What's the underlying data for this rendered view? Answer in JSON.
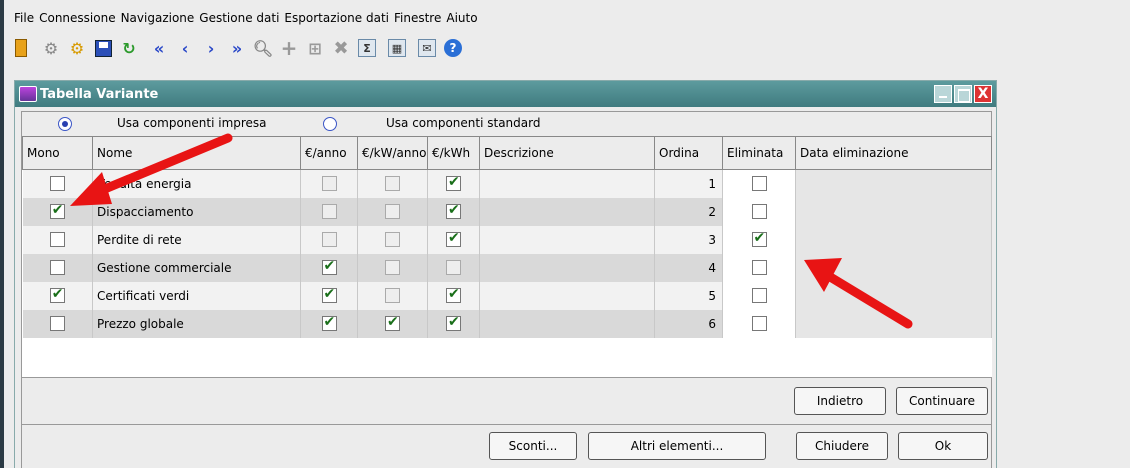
{
  "menu": [
    "File",
    "Connessione",
    "Navigazione",
    "Gestione dati",
    "Esportazione dati",
    "Finestre",
    "Aiuto"
  ],
  "window": {
    "title": "Tabella Variante",
    "close_glyph": "X"
  },
  "radio": {
    "impresa_label": "Usa componenti impresa",
    "standard_label": "Usa componenti standard",
    "selected": "impresa"
  },
  "columns": [
    "Mono",
    "Nome",
    "€/anno",
    "€/kW/anno",
    "€/kWh",
    "Descrizione",
    "Ordina",
    "Eliminata",
    "Data eliminazione"
  ],
  "rows": [
    {
      "mono": false,
      "nome": "Vendita energia",
      "anno": false,
      "kwanno": false,
      "kwh": true,
      "descrizione": "",
      "ordina": "1",
      "eliminata": false,
      "data": ""
    },
    {
      "mono": true,
      "nome": "Dispacciamento",
      "anno": false,
      "kwanno": false,
      "kwh": true,
      "descrizione": "",
      "ordina": "2",
      "eliminata": false,
      "data": ""
    },
    {
      "mono": false,
      "nome": "Perdite di rete",
      "anno": false,
      "kwanno": false,
      "kwh": true,
      "descrizione": "",
      "ordina": "3",
      "eliminata": true,
      "data": ""
    },
    {
      "mono": false,
      "nome": "Gestione commerciale",
      "anno": true,
      "kwanno": false,
      "kwh": false,
      "descrizione": "",
      "ordina": "4",
      "eliminata": false,
      "data": ""
    },
    {
      "mono": true,
      "nome": "Certificati verdi",
      "anno": true,
      "kwanno": false,
      "kwh": true,
      "descrizione": "",
      "ordina": "5",
      "eliminata": false,
      "data": ""
    },
    {
      "mono": false,
      "nome": "Prezzo globale",
      "anno": true,
      "kwanno": true,
      "kwh": true,
      "descrizione": "",
      "ordina": "6",
      "eliminata": false,
      "data": ""
    }
  ],
  "buttons": {
    "indietro": "Indietro",
    "continuare": "Continuare",
    "sconti": "Sconti...",
    "altri": "Altri elementi...",
    "chiudere": "Chiudere",
    "ok": "Ok"
  },
  "colors": {
    "titlebar": "#4a8b8e",
    "arrow": "#e81414",
    "check": "#1a6f1a"
  },
  "toolbar_icons": [
    "exit-icon",
    "connect-icon",
    "disconnect-icon",
    "save-icon",
    "refresh-icon",
    "first-icon",
    "previous-icon",
    "next-icon",
    "last-icon",
    "search-icon",
    "add-icon",
    "edit-icon",
    "delete-icon",
    "sum-icon",
    "calculator-icon",
    "export-icon",
    "help-icon"
  ]
}
